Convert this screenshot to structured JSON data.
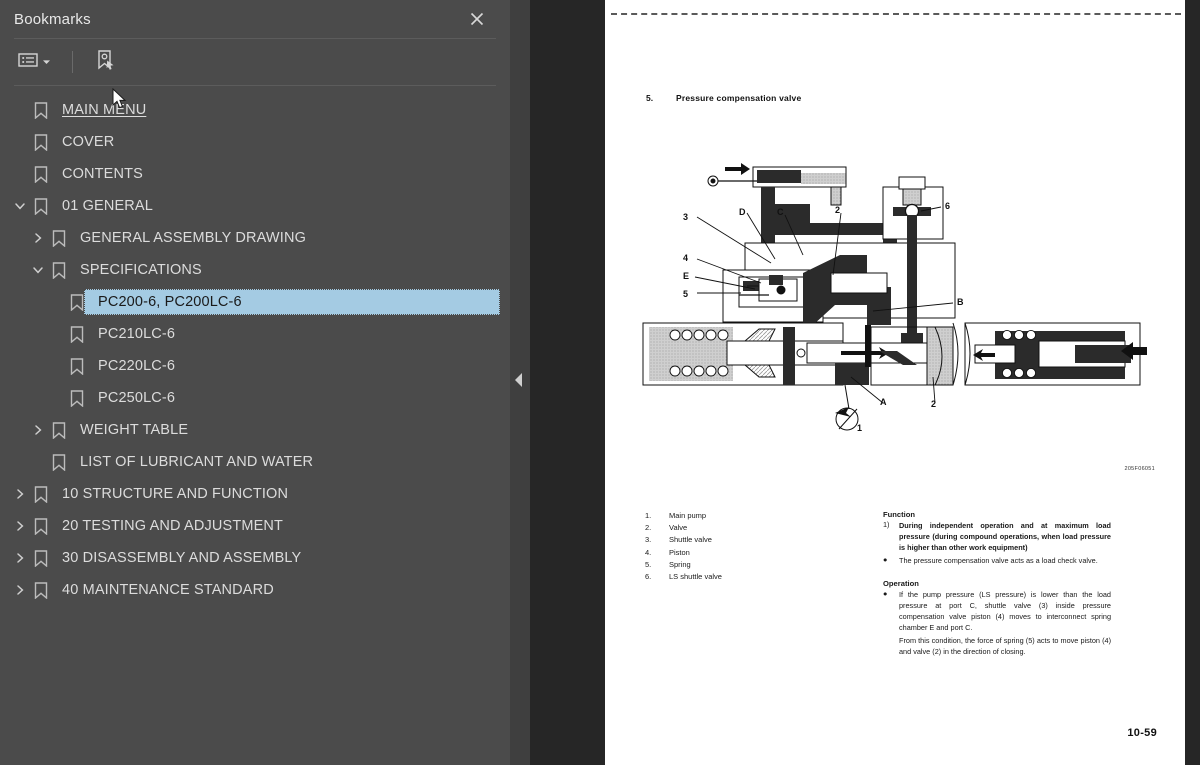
{
  "sidebar": {
    "title": "Bookmarks",
    "close_icon": "close-icon",
    "toolbar": {
      "options_label": "",
      "options_icon": "list-options-icon",
      "dropdown_icon": "chevron-down-icon",
      "new_bookmark_icon": "new-bookmark-icon"
    },
    "items": [
      {
        "label": "MAIN MENU",
        "level": 0,
        "twisty": "none",
        "selected": false,
        "link": true
      },
      {
        "label": "COVER",
        "level": 0,
        "twisty": "none",
        "selected": false,
        "link": false
      },
      {
        "label": "CONTENTS",
        "level": 0,
        "twisty": "none",
        "selected": false,
        "link": false
      },
      {
        "label": "01 GENERAL",
        "level": 0,
        "twisty": "expanded",
        "selected": false,
        "link": false
      },
      {
        "label": "GENERAL ASSEMBLY DRAWING",
        "level": 1,
        "twisty": "collapsed",
        "selected": false,
        "link": false
      },
      {
        "label": "SPECIFICATIONS",
        "level": 1,
        "twisty": "expanded",
        "selected": false,
        "link": false
      },
      {
        "label": "PC200-6, PC200LC-6",
        "level": 2,
        "twisty": "none",
        "selected": true,
        "link": false
      },
      {
        "label": "PC210LC-6",
        "level": 2,
        "twisty": "none",
        "selected": false,
        "link": false
      },
      {
        "label": "PC220LC-6",
        "level": 2,
        "twisty": "none",
        "selected": false,
        "link": false
      },
      {
        "label": "PC250LC-6",
        "level": 2,
        "twisty": "none",
        "selected": false,
        "link": false
      },
      {
        "label": "WEIGHT TABLE",
        "level": 1,
        "twisty": "collapsed",
        "selected": false,
        "link": false
      },
      {
        "label": "LIST OF LUBRICANT AND WATER",
        "level": 1,
        "twisty": "none",
        "selected": false,
        "link": false
      },
      {
        "label": "10 STRUCTURE AND FUNCTION",
        "level": 0,
        "twisty": "collapsed",
        "selected": false,
        "link": false
      },
      {
        "label": "20 TESTING AND ADJUSTMENT",
        "level": 0,
        "twisty": "collapsed",
        "selected": false,
        "link": false
      },
      {
        "label": "30 DISASSEMBLY AND ASSEMBLY",
        "level": 0,
        "twisty": "collapsed",
        "selected": false,
        "link": false
      },
      {
        "label": "40 MAINTENANCE STANDARD",
        "level": 0,
        "twisty": "collapsed",
        "selected": false,
        "link": false
      }
    ]
  },
  "splitter": {
    "collapse_icon": "collapse-panel-arrow-icon"
  },
  "page": {
    "section_number": "5.",
    "section_title": "Pressure compensation valve",
    "figure_code": "205F06051",
    "page_number": "10-59",
    "legend_title": "",
    "legend": [
      {
        "n": "1.",
        "t": "Main pump"
      },
      {
        "n": "2.",
        "t": "Valve"
      },
      {
        "n": "3.",
        "t": "Shuttle valve"
      },
      {
        "n": "4.",
        "t": "Piston"
      },
      {
        "n": "5.",
        "t": "Spring"
      },
      {
        "n": "6.",
        "t": "LS shuttle valve"
      }
    ],
    "function_heading": "Function",
    "function_items": [
      {
        "mark": "1)",
        "text": "During independent operation and at maximum load pressure (during compound operations, when load pressure is higher than other work equipment)",
        "bold": true
      },
      {
        "mark": "●",
        "text": "The pressure compensation valve acts as a load check valve.",
        "bold": false
      }
    ],
    "operation_heading": "Operation",
    "operation_items": [
      {
        "mark": "●",
        "text": "If the pump pressure (LS pressure) is lower than the load pressure at port C, shuttle valve (3) inside pressure compensation valve piston (4) moves to interconnect spring chamber E and port C.",
        "bold": false
      },
      {
        "mark": "",
        "text": "From this condition, the force of spring (5) acts to move piston (4) and valve (2) in the direction of closing.",
        "bold": false
      }
    ],
    "diagram_callouts": [
      "3",
      "D",
      "C",
      "2",
      "6",
      "4",
      "E",
      "5",
      "B",
      "A",
      "1",
      "2"
    ]
  },
  "colors": {
    "panel_bg": "#4b4b4b",
    "viewer_bg": "#262626",
    "selection": "#a4cbe3",
    "text": "#dcdcdc",
    "page_bg": "#ffffff"
  }
}
